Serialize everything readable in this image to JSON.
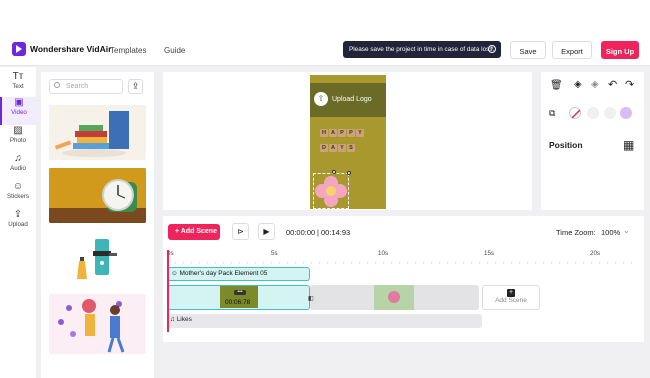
{
  "app": {
    "brand": "Wondershare VidAir"
  },
  "nav": [
    "Templates",
    "Guide"
  ],
  "toast": "Please save the project in time in case of data loss.",
  "header_buttons": {
    "save": "Save",
    "export": "Export",
    "signup": "Sign Up"
  },
  "sidebar": [
    {
      "label": "Text",
      "icon": "text-icon"
    },
    {
      "label": "Video",
      "icon": "video-icon",
      "active": true
    },
    {
      "label": "Photo",
      "icon": "photo-icon"
    },
    {
      "label": "Audio",
      "icon": "audio-icon"
    },
    {
      "label": "Stickers",
      "icon": "sticker-icon"
    },
    {
      "label": "Upload",
      "icon": "upload-icon"
    }
  ],
  "assets": {
    "search_placeholder": "Search"
  },
  "preview": {
    "upload_logo": "Upload Logo",
    "tiles_row1": [
      "H",
      "A",
      "P",
      "P",
      "Y"
    ],
    "tiles_row2": [
      "D",
      "A",
      "Y",
      "S"
    ]
  },
  "properties": {
    "position_label": "Position"
  },
  "timeline": {
    "add_scene": "Add Scene",
    "current_time": "00:00:00",
    "total_time": "00:14:93",
    "zoom_label": "Time Zoom:",
    "zoom_value": "100%",
    "ruler": [
      "0s",
      "5s",
      "10s",
      "15s",
      "20s"
    ],
    "text_track": "Mother's day Pack Element 05",
    "clip_duration": "00:06:78",
    "add_scene_slot": "Add Scene",
    "audio_track": "Likes"
  },
  "colors": {
    "accent": "#f0245c",
    "brand": "#6d28d9",
    "clip": "#3cc3c6"
  }
}
